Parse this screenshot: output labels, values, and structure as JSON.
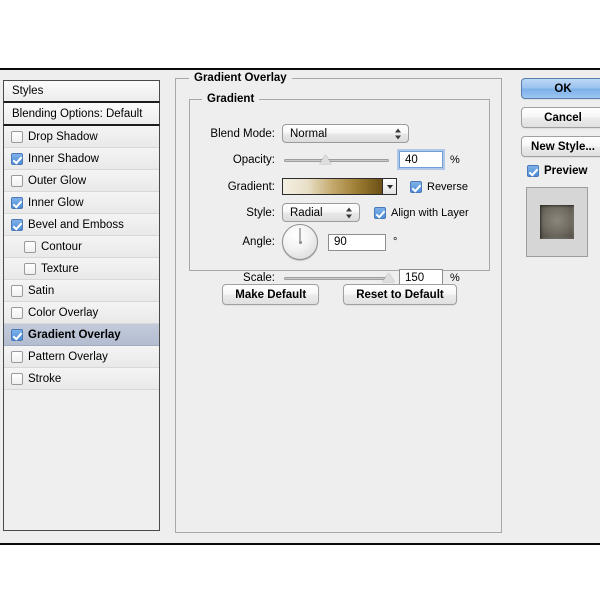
{
  "dialog": {
    "styles_header": "Styles",
    "blending_options": "Blending Options: Default",
    "style_items": [
      {
        "label": "Drop Shadow",
        "checked": false,
        "indent": false,
        "selected": false
      },
      {
        "label": "Inner Shadow",
        "checked": true,
        "indent": false,
        "selected": false
      },
      {
        "label": "Outer Glow",
        "checked": false,
        "indent": false,
        "selected": false
      },
      {
        "label": "Inner Glow",
        "checked": true,
        "indent": false,
        "selected": false
      },
      {
        "label": "Bevel and Emboss",
        "checked": true,
        "indent": false,
        "selected": false
      },
      {
        "label": "Contour",
        "checked": false,
        "indent": true,
        "selected": false
      },
      {
        "label": "Texture",
        "checked": false,
        "indent": true,
        "selected": false
      },
      {
        "label": "Satin",
        "checked": false,
        "indent": false,
        "selected": false
      },
      {
        "label": "Color Overlay",
        "checked": false,
        "indent": false,
        "selected": false
      },
      {
        "label": "Gradient Overlay",
        "checked": true,
        "indent": false,
        "selected": true
      },
      {
        "label": "Pattern Overlay",
        "checked": false,
        "indent": false,
        "selected": false
      },
      {
        "label": "Stroke",
        "checked": false,
        "indent": false,
        "selected": false
      }
    ]
  },
  "panel": {
    "title": "Gradient Overlay",
    "group_title": "Gradient",
    "blend_mode": {
      "label": "Blend Mode:",
      "value": "Normal"
    },
    "opacity": {
      "label": "Opacity:",
      "value": "40",
      "unit": "%",
      "slider_percent": 40
    },
    "gradient": {
      "label": "Gradient:",
      "stops": [
        "#f3efe3",
        "#e8dfc6",
        "#c4a96d",
        "#9d7d33",
        "#6b4f15"
      ],
      "reverse_label": "Reverse",
      "reverse_checked": true
    },
    "style": {
      "label": "Style:",
      "value": "Radial",
      "align_label": "Align with Layer",
      "align_checked": true
    },
    "angle": {
      "label": "Angle:",
      "value": "90",
      "unit": "°",
      "degrees": 90
    },
    "scale": {
      "label": "Scale:",
      "value": "150",
      "unit": "%",
      "slider_percent": 100
    },
    "make_default": "Make Default",
    "reset_to_default": "Reset to Default"
  },
  "buttons": {
    "ok": "OK",
    "cancel": "Cancel",
    "new_style": "New Style...",
    "preview_label": "Preview",
    "preview_checked": true
  },
  "colors": {
    "accent": "#4d8ed6",
    "selection": "#b3bdd0",
    "dialog_bg": "#eeeeee"
  }
}
